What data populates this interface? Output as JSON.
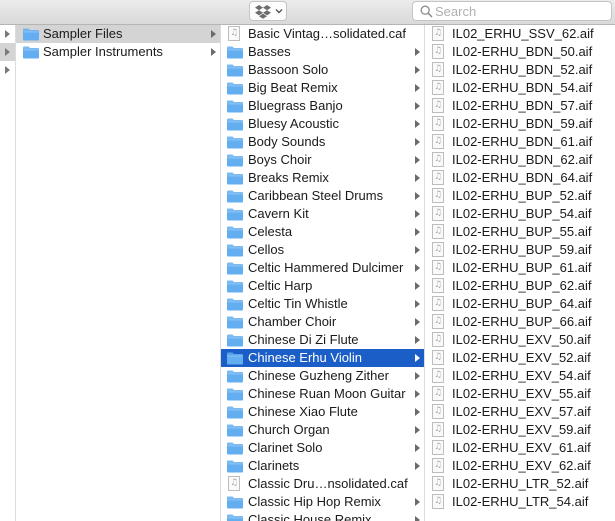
{
  "toolbar": {
    "search_placeholder": "Search",
    "dropbox_icon": "dropbox-icon",
    "chevron_icon": "chevron-down-icon",
    "search_icon": "magnifier-icon"
  },
  "colors": {
    "folder": "#62aef0",
    "selection_active": "#1b5ec7",
    "selection_inactive": "#d4d4d4"
  },
  "column1": {
    "items": [
      {
        "label": "Sampler Files",
        "type": "folder",
        "state": "selected-inactive"
      },
      {
        "label": "Sampler Instruments",
        "type": "folder",
        "state": "none"
      }
    ]
  },
  "column2": {
    "items": [
      {
        "label": "Basic Vintag…solidated.caf",
        "type": "file"
      },
      {
        "label": "Basses",
        "type": "folder"
      },
      {
        "label": "Bassoon Solo",
        "type": "folder"
      },
      {
        "label": "Big Beat Remix",
        "type": "folder"
      },
      {
        "label": "Bluegrass Banjo",
        "type": "folder"
      },
      {
        "label": "Bluesy Acoustic",
        "type": "folder"
      },
      {
        "label": "Body Sounds",
        "type": "folder"
      },
      {
        "label": "Boys Choir",
        "type": "folder"
      },
      {
        "label": "Breaks Remix",
        "type": "folder"
      },
      {
        "label": "Caribbean Steel Drums",
        "type": "folder"
      },
      {
        "label": "Cavern Kit",
        "type": "folder"
      },
      {
        "label": "Celesta",
        "type": "folder"
      },
      {
        "label": "Cellos",
        "type": "folder"
      },
      {
        "label": "Celtic Hammered Dulcimer",
        "type": "folder"
      },
      {
        "label": "Celtic Harp",
        "type": "folder"
      },
      {
        "label": "Celtic Tin Whistle",
        "type": "folder"
      },
      {
        "label": "Chamber Choir",
        "type": "folder"
      },
      {
        "label": "Chinese Di Zi Flute",
        "type": "folder"
      },
      {
        "label": "Chinese Erhu Violin",
        "type": "folder",
        "state": "selected-active"
      },
      {
        "label": "Chinese Guzheng Zither",
        "type": "folder"
      },
      {
        "label": "Chinese Ruan Moon Guitar",
        "type": "folder"
      },
      {
        "label": "Chinese Xiao Flute",
        "type": "folder"
      },
      {
        "label": "Church Organ",
        "type": "folder"
      },
      {
        "label": "Clarinet Solo",
        "type": "folder"
      },
      {
        "label": "Clarinets",
        "type": "folder"
      },
      {
        "label": "Classic Dru…nsolidated.caf",
        "type": "file"
      },
      {
        "label": "Classic Hip Hop Remix",
        "type": "folder"
      },
      {
        "label": "Classic House Remix",
        "type": "folder"
      }
    ]
  },
  "column3": {
    "items": [
      {
        "label": "IL02_ERHU_SSV_62.aif"
      },
      {
        "label": "IL02-ERHU_BDN_50.aif"
      },
      {
        "label": "IL02-ERHU_BDN_52.aif"
      },
      {
        "label": "IL02-ERHU_BDN_54.aif"
      },
      {
        "label": "IL02-ERHU_BDN_57.aif"
      },
      {
        "label": "IL02-ERHU_BDN_59.aif"
      },
      {
        "label": "IL02-ERHU_BDN_61.aif"
      },
      {
        "label": "IL02-ERHU_BDN_62.aif"
      },
      {
        "label": "IL02-ERHU_BDN_64.aif"
      },
      {
        "label": "IL02-ERHU_BUP_52.aif"
      },
      {
        "label": "IL02-ERHU_BUP_54.aif"
      },
      {
        "label": "IL02-ERHU_BUP_55.aif"
      },
      {
        "label": "IL02-ERHU_BUP_59.aif"
      },
      {
        "label": "IL02-ERHU_BUP_61.aif"
      },
      {
        "label": "IL02-ERHU_BUP_62.aif"
      },
      {
        "label": "IL02-ERHU_BUP_64.aif"
      },
      {
        "label": "IL02-ERHU_BUP_66.aif"
      },
      {
        "label": "IL02-ERHU_EXV_50.aif"
      },
      {
        "label": "IL02-ERHU_EXV_52.aif"
      },
      {
        "label": "IL02-ERHU_EXV_54.aif"
      },
      {
        "label": "IL02-ERHU_EXV_55.aif"
      },
      {
        "label": "IL02-ERHU_EXV_57.aif"
      },
      {
        "label": "IL02-ERHU_EXV_59.aif"
      },
      {
        "label": "IL02-ERHU_EXV_61.aif"
      },
      {
        "label": "IL02-ERHU_EXV_62.aif"
      },
      {
        "label": "IL02-ERHU_LTR_52.aif"
      },
      {
        "label": "IL02-ERHU_LTR_54.aif"
      }
    ]
  }
}
